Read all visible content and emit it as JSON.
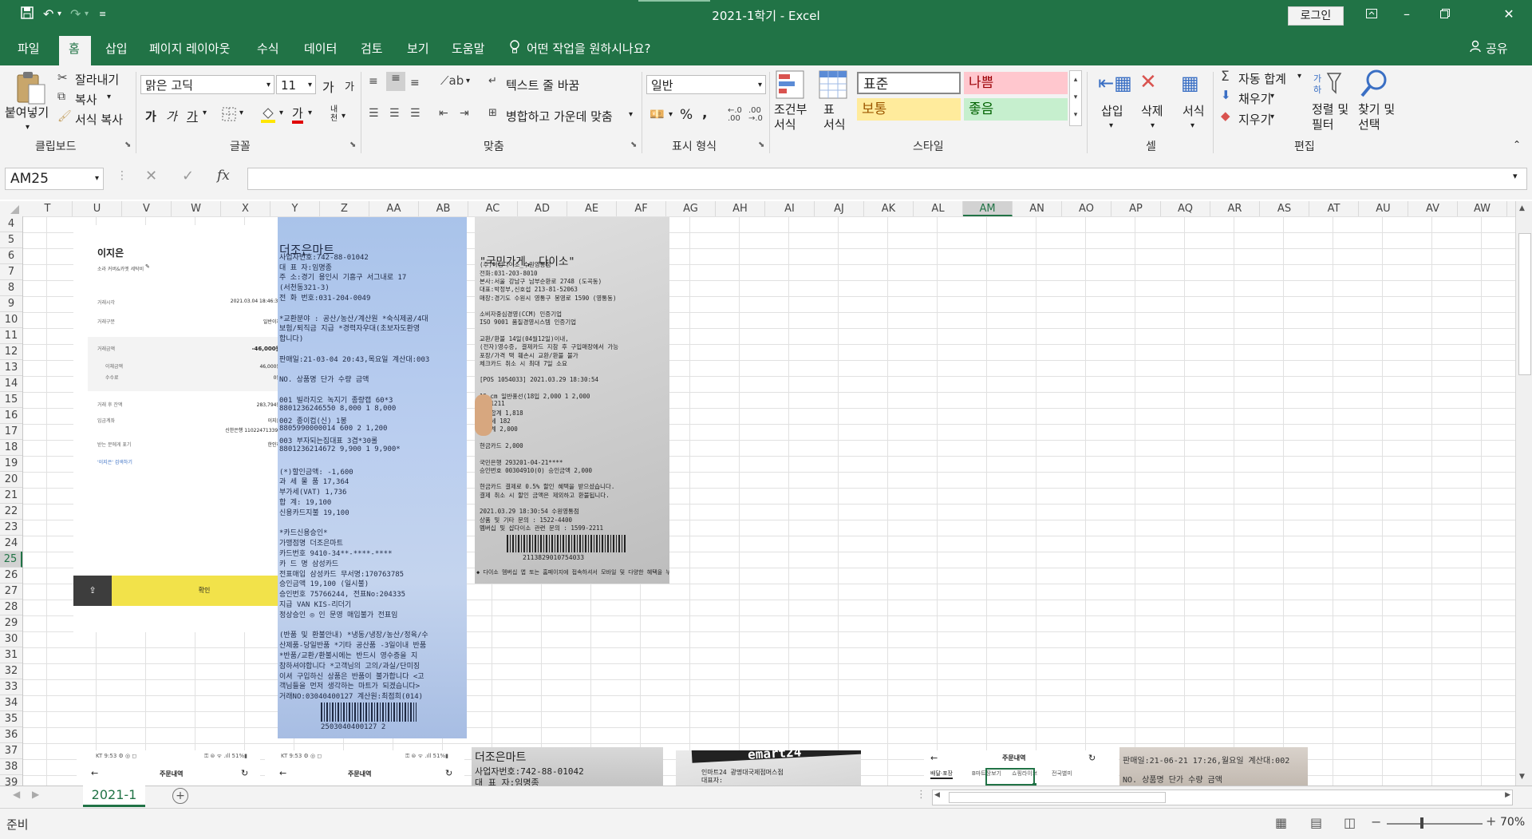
{
  "window": {
    "title": "2021-1학기  -  Excel",
    "login_label": "로그인",
    "colors": {
      "accent": "#217346",
      "selected_cell": "#217346"
    }
  },
  "quick_access": {
    "icons": [
      "save-icon",
      "undo-icon",
      "redo-icon",
      "customize-icon"
    ]
  },
  "menu": {
    "tabs": [
      "파일",
      "홈",
      "삽입",
      "페이지 레이아웃",
      "수식",
      "데이터",
      "검토",
      "보기",
      "도움말"
    ],
    "active_tab": "홈",
    "search_label": "어떤 작업을 원하시나요?",
    "share_label": "공유"
  },
  "ribbon": {
    "clipboard": {
      "paste": "붙여넣기",
      "cut": "잘라내기",
      "copy": "복사",
      "format_painter": "서식 복사",
      "group": "클립보드"
    },
    "font": {
      "name": "맑은 고딕",
      "size": "11",
      "grow": "가",
      "shrink": "가",
      "bold": "가",
      "italic": "가",
      "underline": "가",
      "font_color_glyph": "가",
      "phonetic": "내천",
      "group": "글꼴"
    },
    "alignment": {
      "wrap": "텍스트 줄 바꿈",
      "merge": "병합하고 가운데 맞춤",
      "group": "맞춤"
    },
    "number": {
      "format": "일반",
      "percent": "%",
      "comma": ",",
      "group": "표시 형식"
    },
    "styles": {
      "conditional": "조건부\n서식",
      "table": "표\n서식",
      "normal": "표준",
      "bad": "나쁨",
      "neutral": "보통",
      "good": "좋음",
      "group": "스타일"
    },
    "cells": {
      "insert": "삽입",
      "delete": "삭제",
      "format": "서식",
      "group": "셀"
    },
    "editing": {
      "autosum": "자동 합계",
      "fill": "채우기",
      "clear": "지우기",
      "sort": "정렬 및\n필터",
      "find": "찾기 및\n선택",
      "group": "편집"
    }
  },
  "formula_bar": {
    "name_box": "AM25",
    "fx": "fx",
    "value": ""
  },
  "grid": {
    "columns": [
      "T",
      "U",
      "V",
      "W",
      "X",
      "Y",
      "Z",
      "AA",
      "AB",
      "AC",
      "AD",
      "AE",
      "AF",
      "AG",
      "AH",
      "AI",
      "AJ",
      "AK",
      "AL",
      "AM",
      "AN",
      "AO",
      "AP",
      "AQ",
      "AR",
      "AS",
      "AT",
      "AU",
      "AV",
      "AW"
    ],
    "rows": [
      "4",
      "5",
      "6",
      "7",
      "8",
      "9",
      "10",
      "11",
      "12",
      "13",
      "14",
      "15",
      "16",
      "17",
      "18",
      "19",
      "20",
      "21",
      "22",
      "23",
      "24",
      "25",
      "26",
      "27",
      "28",
      "29",
      "30",
      "31",
      "32",
      "33",
      "34",
      "35",
      "36",
      "37",
      "38",
      "39"
    ],
    "selected_column": "AM",
    "selected_row": "25"
  },
  "sheets": {
    "tabs": [
      "2021-1"
    ],
    "active": "2021-1"
  },
  "status": {
    "text": "준비",
    "zoom": "70%"
  },
  "images": {
    "phone_receipt": {
      "name": "이지은",
      "subtitle": "소라 커버&카멧 세탁비",
      "rows": [
        [
          "거래시각",
          "2021.03.04 18:46:33"
        ],
        [
          "거래구분",
          "일반이체"
        ],
        [
          "거래금액",
          "-46,000원"
        ],
        [
          "이체금액",
          "46,000원"
        ],
        [
          "수수료",
          "0원"
        ],
        [
          "거래 후 잔액",
          "283,794원"
        ],
        [
          "입금계좌",
          "이지은"
        ],
        [
          "",
          "신한은행 110224713398"
        ],
        [
          "받는 분에게 표기",
          "한인하"
        ],
        [
          "'이지은' 검색하기",
          "›"
        ]
      ],
      "confirm": "확인"
    },
    "receipt_1": {
      "lines": [
        "더조은마트",
        "사업자번호:742-88-01042",
        "대  표  자:임명종",
        "주     소:경기 용인시 기흥구 서그내로 17",
        "(서천동321-3)",
        "전 화 번호:031-204-0049",
        "",
        "*교환분야 : 공산/농산/계산원 *숙식제공/4대",
        "보험/퇴직금 지급 *경력자우대(초보자도환영",
        "합니다)",
        "",
        "판매일:21-03-04 20:43,목요일 계산대:003",
        "",
        "NO.  상품명        단가  수량    금액",
        "",
        "001 빌라지오 녹지기 종량캡 60*3",
        "    8801236246550   8,000    1     8,000",
        "002 종이컵(신) 1봉",
        "    8805990000014     600    2     1,200",
        "003 부자되는집대표 3겹*30롤",
        "    8801236214672   9,900    1     9,900*",
        "",
        "  (*)할인금액:                   -1,600",
        "  과 세 물 품                    17,364",
        "  부가세(VAT)                     1,736",
        "  합    계:                     19,100",
        "  신용카드지불                    19,100",
        "",
        "*카드신용승인*",
        "가맹점명   더조은마트",
        "카드번호   9410-34**-****-****",
        "카 드 명   삼성카드",
        "전표매입   삼성카드 무서명:170763785",
        "승인금액   19,100      (일시불)",
        "승인번호   75766244, 전표No:204335",
        "지급 VAN   KIS-리더기",
        "정상승인 ◎     인 문영 매입불가 전표임",
        "",
        "(반품 및 환불안내) *냉동/냉장/농산/정육/수",
        "산제품-당일반품 *기타 공산품 -3일이내 반품",
        "*반품/교환/환불시에는 반드시 영수증을 지",
        "참하셔야합니다 *고객님의 고의/과실/단미징",
        "이셔 구입하신 상품은 반품이 불가합니다 <고",
        "객님들을 먼저 생각하는 마트가 되겠습니다>",
        "거래NO:03040400127 계산원:최점희(014)"
      ],
      "barcode": "2503040400127 2"
    },
    "receipt_2": {
      "lines": [
        "\"국민가게, 다이소\"",
        "(주)아성다이소_수원영통점",
        "전화:031-203-8010",
        "본사:서울 강남구 남부순환로 2748 (도곡동)",
        "대표:박정부,신호섭 213-81-52063",
        "매장:경기도 수원시 영통구 봉영로 1590 (영통동)",
        "",
        "소비자중심경영(CCM) 인증기업",
        "ISO 9001 품질경영시스템 인증기업",
        "",
        "교환/환불 14일(04월12일)이내,",
        "(전자)영수증, 결제카드 지참 후 구입매장에서 가능",
        "포장/가격 택 훼손시 교환/환불 불가",
        "체크카드 취소 시 최대 7일 소요",
        "",
        "[POS 1054033]            2021.03.29 18:30:54",
        "",
        "15 cm 일반풍선(18입       2,000    1   2,000",
        "1021211",
        "              과세합계              1,818",
        "              부가세                  182",
        "판매계                              2,000",
        "",
        "현금카드                            2,000",
        "",
        "국민은행                  293201-04-21****",
        "승인번호 00304910(0)           승인금액 2,000",
        "",
        "현금카드 결제로 0.5% 할인 혜택을 받으셨습니다.",
        "결제 취소 시 할인 금액은 제외하고 환불됩니다.",
        "",
        "2021.03.29 18:30:54 수원영통점",
        "상품 및 기타 문의 : 1522-4400",
        "멤버십 및 샵다이소 관련 문의 : 1599-2211"
      ],
      "barcode": "2113829010754033",
      "footer": "◆ 다이소 멤버십 앱 또는 홈페이지에 접속하셔서 모바일 및 다양한 혜택을 누려보세요! ◆"
    },
    "partial_phone_1": {
      "status": "KT 9:53 ⚙ ◎ ◻",
      "signal": "⚿ ⊜ ᯤ .ıll 51%▮",
      "title": "주문내역"
    },
    "partial_phone_2": {
      "status": "KT 9:53 ⚙ ◎ ◻",
      "signal": "⚿ ⊜ ᯤ .ıll 51%▮",
      "title": "주문내역"
    },
    "partial_receipt_3": {
      "lines": [
        "더조은마트",
        "사업자번호:742-88-01042",
        "대  표  자:임명종"
      ]
    },
    "partial_receipt_4": {
      "lines": [
        "emart24",
        "인마트24 광명대국제점머스점",
        "대표자:"
      ]
    },
    "partial_phone_3": {
      "title": "주문내역",
      "tabs": [
        "배달·포장",
        "B마트장보기",
        "쇼핑라이브",
        "전국별미"
      ]
    },
    "partial_receipt_5": {
      "lines": [
        "판매일:21-06-21 17:26,월요일 계산대:002",
        "NO. 상품명      단가   수량    금액"
      ]
    }
  }
}
